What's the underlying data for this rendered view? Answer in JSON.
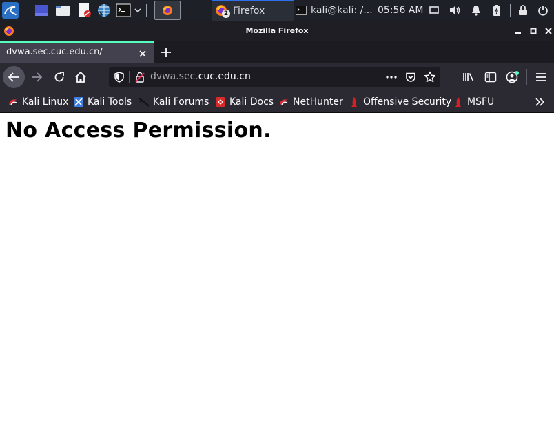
{
  "panel": {
    "tasks": [
      {
        "label": "Firefox",
        "badge": "2",
        "icon": "firefox-icon"
      },
      {
        "label": "kali@kali: /...",
        "icon": "terminal-icon"
      }
    ],
    "clock": "05:56 AM"
  },
  "window": {
    "title": "Mozilla Firefox"
  },
  "tabs": [
    {
      "title": "dvwa.sec.cuc.edu.cn/"
    }
  ],
  "urlbar": {
    "prefix": "dvwa.sec.",
    "host": "cuc.edu.cn"
  },
  "bookmarks": [
    {
      "label": "Kali Linux",
      "icon": "kali-dragon-icon"
    },
    {
      "label": "Kali Tools",
      "icon": "kali-tools-icon"
    },
    {
      "label": "Kali Forums",
      "icon": "kali-forums-icon"
    },
    {
      "label": "Kali Docs",
      "icon": "kali-docs-icon"
    },
    {
      "label": "NetHunter",
      "icon": "nethunter-icon"
    },
    {
      "label": "Offensive Security",
      "icon": "offsec-icon"
    },
    {
      "label": "MSFU",
      "icon": "msfu-icon"
    }
  ],
  "page": {
    "heading": "No Access Permission."
  },
  "colors": {
    "panel_bg": "#1d2027",
    "tab_accent": "#54ffbd",
    "toolbar_bg": "#2b2a33",
    "urlbar_bg": "#1c1b22"
  }
}
